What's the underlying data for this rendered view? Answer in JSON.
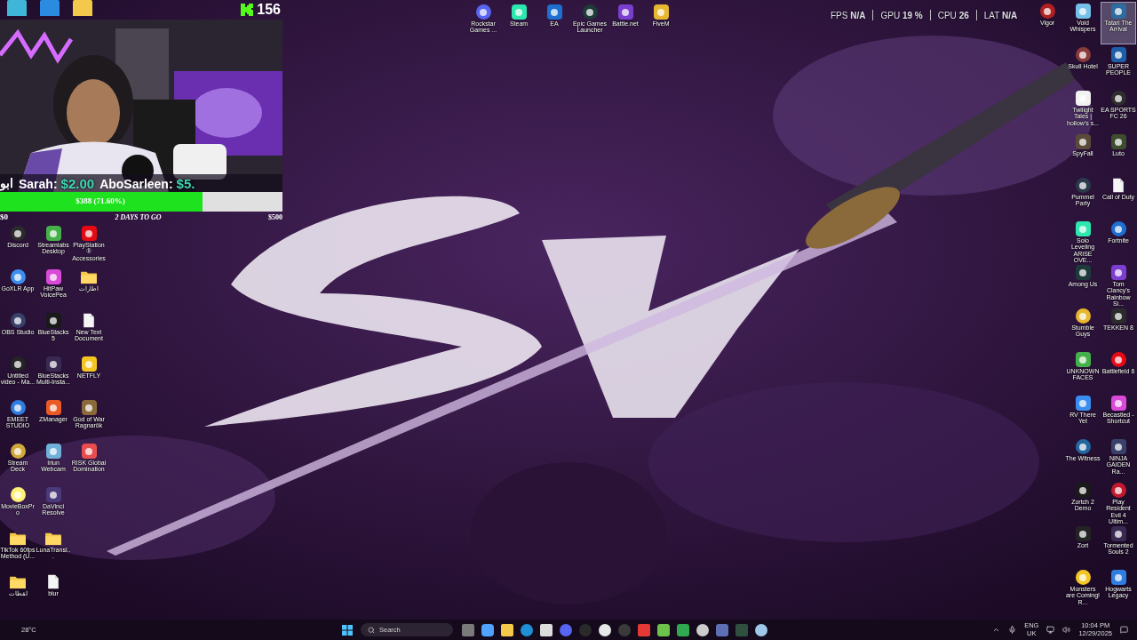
{
  "desktop": {
    "top_icons": [
      {
        "label": "Rockstar Games ...",
        "kind": "app",
        "selected": false
      },
      {
        "label": "Steam",
        "kind": "app",
        "selected": false
      },
      {
        "label": "EA",
        "kind": "app",
        "selected": false
      },
      {
        "label": "Epic Games Launcher",
        "kind": "app",
        "selected": false
      },
      {
        "label": "Battle.net",
        "kind": "app",
        "selected": false
      },
      {
        "label": "FiveM",
        "kind": "app",
        "selected": false
      }
    ],
    "left_icons": [
      [
        {
          "label": "Discord",
          "kind": "app",
          "selected": false
        },
        {
          "label": "Streamlabs Desktop",
          "kind": "app",
          "selected": false
        },
        {
          "label": "PlayStation® Accessories",
          "kind": "app",
          "selected": false
        }
      ],
      [
        {
          "label": "GoXLR App",
          "kind": "app",
          "selected": false
        },
        {
          "label": "HitPaw VoicePea",
          "kind": "app",
          "selected": false
        },
        {
          "label": "اطارات",
          "kind": "folder",
          "selected": false
        }
      ],
      [
        {
          "label": "OBS Studio",
          "kind": "app",
          "selected": false
        },
        {
          "label": "BlueStacks 5",
          "kind": "app",
          "selected": false
        },
        {
          "label": "New Text Document",
          "kind": "file",
          "selected": false
        }
      ],
      [
        {
          "label": "Untitled video - Ma...",
          "kind": "app",
          "selected": false
        },
        {
          "label": "BlueStacks Multi-Insta...",
          "kind": "app",
          "selected": false
        },
        {
          "label": "NETFLY",
          "kind": "app",
          "selected": false
        }
      ],
      [
        {
          "label": "EMEET STUDIO",
          "kind": "app",
          "selected": false
        },
        {
          "label": "ZManager",
          "kind": "app",
          "selected": false
        },
        {
          "label": "God of War Ragnarök",
          "kind": "app",
          "selected": false
        }
      ],
      [
        {
          "label": "Stream Deck",
          "kind": "app",
          "selected": false
        },
        {
          "label": "Iriun Webcam",
          "kind": "app",
          "selected": false
        },
        {
          "label": "RISK Global Domination",
          "kind": "app",
          "selected": false
        }
      ],
      [
        {
          "label": "MovieBoxPro",
          "kind": "app",
          "selected": false
        },
        {
          "label": "DaVinci Resolve",
          "kind": "app",
          "selected": false
        }
      ],
      [
        {
          "label": "TikTok 60fps Method (U...",
          "kind": "folder",
          "selected": false
        },
        {
          "label": "LunaTransl...",
          "kind": "folder",
          "selected": false
        }
      ],
      [
        {
          "label": "لقطات",
          "kind": "folder",
          "selected": false
        },
        {
          "label": "blur",
          "kind": "file",
          "selected": false
        }
      ]
    ],
    "right_icons": [
      [
        {
          "label": "Vigor",
          "kind": "app",
          "selected": false
        },
        {
          "label": "Void Whispers",
          "kind": "app",
          "selected": false
        },
        {
          "label": "Tatari The Arrival",
          "kind": "app",
          "selected": true
        }
      ],
      [
        {
          "label": "Skull Hotel",
          "kind": "app",
          "selected": false
        },
        {
          "label": "SUPER PEOPLE",
          "kind": "app",
          "selected": false
        }
      ],
      [
        {
          "label": "Twilight Tales | hollow's s...",
          "kind": "app",
          "selected": false
        },
        {
          "label": "EA SPORTS FC 26",
          "kind": "app",
          "selected": false
        }
      ],
      [
        {
          "label": "SpyFall",
          "kind": "app",
          "selected": false
        },
        {
          "label": "Luto",
          "kind": "app",
          "selected": false
        }
      ],
      [
        {
          "label": "Pummel Party",
          "kind": "app",
          "selected": false
        },
        {
          "label": "Call of Duty",
          "kind": "file",
          "selected": false
        }
      ],
      [
        {
          "label": "Solo Leveling ARISE OVE...",
          "kind": "app",
          "selected": false
        },
        {
          "label": "Fortnite",
          "kind": "app",
          "selected": false
        }
      ],
      [
        {
          "label": "Among Us",
          "kind": "app",
          "selected": false
        },
        {
          "label": "Tom Clancy's Rainbow Si...",
          "kind": "app",
          "selected": false
        }
      ],
      [
        {
          "label": "Stumble Guys",
          "kind": "app",
          "selected": false
        },
        {
          "label": "TEKKEN 8",
          "kind": "app",
          "selected": false
        }
      ],
      [
        {
          "label": "UNKNOWN FACES",
          "kind": "app",
          "selected": false
        },
        {
          "label": "Battlefield 6",
          "kind": "app",
          "selected": false
        }
      ],
      [
        {
          "label": "RV There Yet",
          "kind": "app",
          "selected": false
        },
        {
          "label": "Becastled - Shortcut",
          "kind": "app",
          "selected": false
        }
      ],
      [
        {
          "label": "The Witness",
          "kind": "app",
          "selected": false
        },
        {
          "label": "NINJA GAIDEN Ra...",
          "kind": "app",
          "selected": false
        }
      ],
      [
        {
          "label": "Zortch 2 Demo",
          "kind": "app",
          "selected": false
        },
        {
          "label": "Play Resident Evil 4 Ultim...",
          "kind": "app",
          "selected": false
        }
      ],
      [
        {
          "label": "Zort",
          "kind": "app",
          "selected": false
        },
        {
          "label": "Tormented Souls 2",
          "kind": "app",
          "selected": false
        }
      ],
      [
        {
          "label": "Monsters are Coming! R...",
          "kind": "app",
          "selected": false
        },
        {
          "label": "Hogwarts Legacy",
          "kind": "app",
          "selected": false
        }
      ]
    ]
  },
  "stream_overlay": {
    "follower_count": "156",
    "donations": [
      {
        "name": "ابو"
      },
      {
        "name": "Sarah:",
        "amount": "$2.00"
      },
      {
        "name": "AboSarleen:",
        "amount": "$5."
      }
    ],
    "goal": {
      "label": "$388 (71.60%)",
      "level": 0.716,
      "min": "$0",
      "remaining": "2 DAYS TO GO",
      "max": "$500"
    }
  },
  "performance_overlay": [
    {
      "label": "FPS",
      "value": "N/A"
    },
    {
      "label": "GPU",
      "value": "19 %"
    },
    {
      "label": "CPU",
      "value": "26"
    },
    {
      "label": "LAT",
      "value": "N/A"
    }
  ],
  "taskbar": {
    "weather": "28°C",
    "search_placeholder": "Search",
    "language": "ENG",
    "region": "UK",
    "time": "10:04 PM",
    "date": "12/29/2025"
  }
}
